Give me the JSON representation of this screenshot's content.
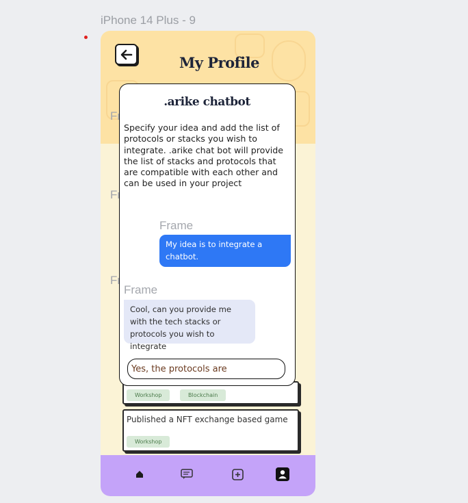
{
  "canvas": {
    "frame_title": "iPhone 14 Plus - 9"
  },
  "header": {
    "title": "My Profile",
    "back_icon": "arrow-left-icon"
  },
  "ghost_labels": [
    "Frame",
    "Frame",
    "Frame"
  ],
  "background_cards": [
    {
      "title": "",
      "tags": [
        "Workshop",
        "Blockchain"
      ]
    },
    {
      "title": "Published a NFT exchange based game",
      "tags": [
        "Workshop"
      ]
    }
  ],
  "modal": {
    "title": ".arike chatbot",
    "description": "Specify your idea and add the list of protocols or stacks you wish to integrate. .arike chat bot will provide the list of stacks and protocols that are compatible with each other and can be used in your project",
    "user_frame_label": "Frame",
    "bot_frame_label": "Frame",
    "user_message": "My idea is to integrate a chatbot.",
    "bot_message": "Cool, can you provide me with the tech stacks or protocols you wish to integrate",
    "input_value": "Yes, the protocols are"
  },
  "nav": {
    "items": [
      "home-icon",
      "chat-icon",
      "add-icon",
      "profile-icon"
    ],
    "accent": "#c4a3f9"
  },
  "colors": {
    "header_bg": "#fde2a4",
    "user_bubble": "#2e78f5",
    "bot_bubble": "#e4e8f7"
  }
}
